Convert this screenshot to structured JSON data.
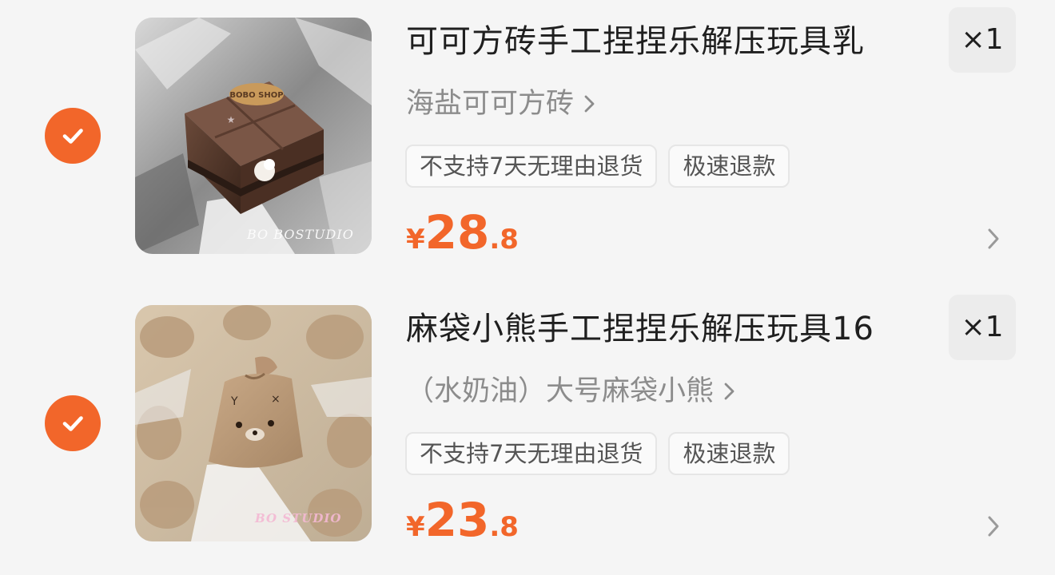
{
  "items": [
    {
      "title": "可可方砖手工捏捏乐解压玩具乳",
      "spec": "海盐可可方砖",
      "tags": [
        "不支持7天无理由退货",
        "极速退款"
      ],
      "price": {
        "currency": "¥",
        "integer": "28",
        "decimal": ".8"
      },
      "quantity": "×1",
      "image_watermark": "BO BOSTUDIO",
      "selected": true
    },
    {
      "title": "麻袋小熊手工捏捏乐解压玩具16",
      "spec": "（水奶油）大号麻袋小熊",
      "tags": [
        "不支持7天无理由退货",
        "极速退款"
      ],
      "price": {
        "currency": "¥",
        "integer": "23",
        "decimal": ".8"
      },
      "quantity": "×1",
      "image_watermark": "BO STUDIO",
      "selected": true
    }
  ],
  "colors": {
    "accent": "#f2662a",
    "background": "#f5f5f5",
    "secondary_text": "#8c8c8c"
  },
  "icons": {
    "check": "check-icon",
    "spec_chevron": "chevron-right-icon",
    "row_chevron": "chevron-right-icon"
  }
}
